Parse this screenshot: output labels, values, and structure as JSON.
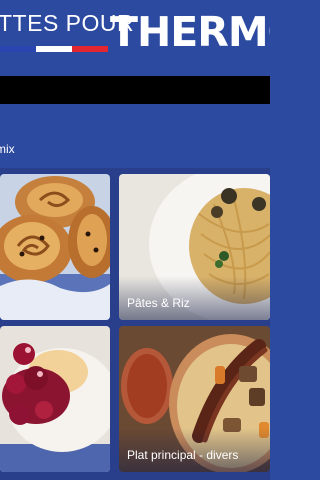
{
  "banner": {
    "small_text": "TTES POUR",
    "brand_text": "THERMO",
    "flag_colors": [
      "#2a45b0",
      "#ffffff",
      "#e3262f"
    ]
  },
  "appbar": {
    "title": "mix"
  },
  "categories": [
    {
      "label": "",
      "image": "brioche-rolls"
    },
    {
      "label": "Pâtes & Riz",
      "image": "spaghetti-plate"
    },
    {
      "label": "",
      "image": "cherry-dessert"
    },
    {
      "label": "Plat principal - divers",
      "image": "sausage-couscous"
    }
  ],
  "colors": {
    "primary": "#2d4aa1",
    "status_bar": "#000000"
  }
}
